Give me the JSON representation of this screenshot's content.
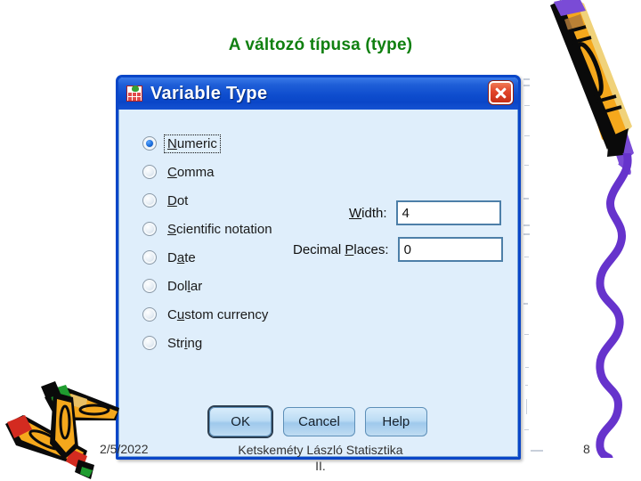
{
  "slide": {
    "title": "A változó típusa (type)"
  },
  "dialog": {
    "title": "Variable Type",
    "window_icon": "variable-grid-icon",
    "close_icon": "close-icon",
    "radio_options": [
      {
        "label": "Numeric",
        "mnemonic": "N",
        "before": "",
        "after": "umeric",
        "selected": true,
        "focused": true
      },
      {
        "label": "Comma",
        "mnemonic": "C",
        "before": "",
        "after": "omma",
        "selected": false,
        "focused": false
      },
      {
        "label": "Dot",
        "mnemonic": "D",
        "before": "",
        "after": "ot",
        "selected": false,
        "focused": false
      },
      {
        "label": "Scientific notation",
        "mnemonic": "S",
        "before": "",
        "after": "cientific notation",
        "selected": false,
        "focused": false
      },
      {
        "label": "Date",
        "mnemonic": "a",
        "before": "D",
        "after": "te",
        "selected": false,
        "focused": false
      },
      {
        "label": "Dollar",
        "mnemonic": "l",
        "before": "Dol",
        "after": "ar",
        "selected": false,
        "focused": false
      },
      {
        "label": "Custom currency",
        "mnemonic": "u",
        "before": "C",
        "after": "stom currency",
        "selected": false,
        "focused": false
      },
      {
        "label": "String",
        "mnemonic": "i",
        "before": "Str",
        "after": "ng",
        "selected": false,
        "focused": false
      }
    ],
    "fields": {
      "width": {
        "label": "Width:",
        "label_before": "",
        "label_mnemonic": "W",
        "label_after": "idth:",
        "value": "4"
      },
      "decimal_places": {
        "label": "Decimal Places:",
        "label_before": "Decimal ",
        "label_mnemonic": "P",
        "label_after": "laces:",
        "value": "0"
      }
    },
    "buttons": {
      "ok": "OK",
      "cancel": "Cancel",
      "help": "Help"
    }
  },
  "footer": {
    "date": "2/5/2022",
    "center_line1": "Ketskeméty László Statisztika",
    "center_line2": "II.",
    "page": "8"
  },
  "decorations": {
    "crayon_top_right": "crayon-icon",
    "squiggle_right": "squiggle-icon",
    "crayons_bottom_left": "crayons-icon"
  },
  "colors": {
    "title_green": "#108010",
    "titlebar_blue": "#0a46c8",
    "dialog_body": "#dfeefb",
    "close_red": "#c72f18",
    "crayon_yellow": "#f5a81c",
    "squiggle_purple": "#6633cc"
  }
}
